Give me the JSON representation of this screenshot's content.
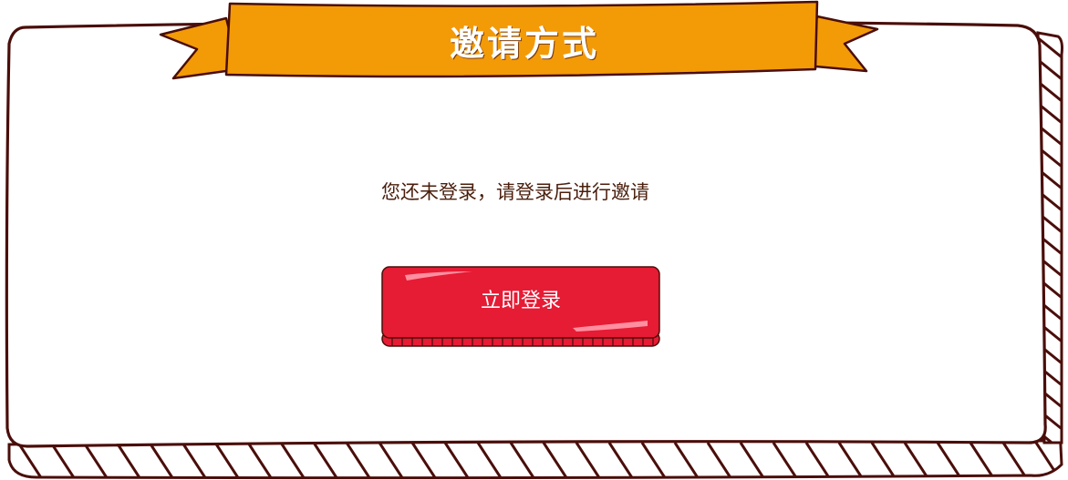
{
  "dialog": {
    "title": "邀请方式",
    "message": "您还未登录，请登录后进行邀请",
    "login_button_label": "立即登录"
  },
  "icons": {
    "title_banner": "ribbon-banner"
  },
  "colors": {
    "ribbon": "#f39a07",
    "border": "#4a0e0a",
    "button": "#e61b34",
    "button_highlight": "#ff6e84",
    "text": "#4a1e0c",
    "background": "#ffffff"
  }
}
